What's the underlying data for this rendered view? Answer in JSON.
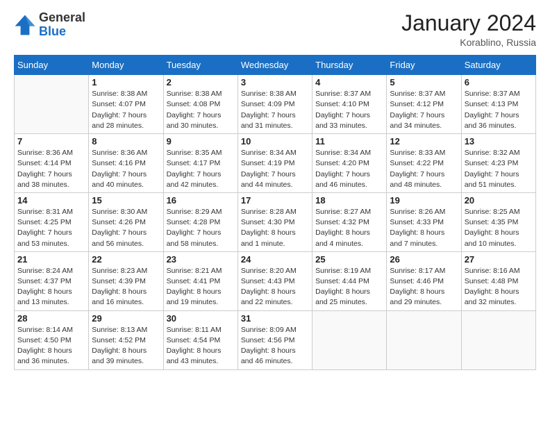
{
  "logo": {
    "general": "General",
    "blue": "Blue"
  },
  "title": "January 2024",
  "location": "Korablino, Russia",
  "days_header": [
    "Sunday",
    "Monday",
    "Tuesday",
    "Wednesday",
    "Thursday",
    "Friday",
    "Saturday"
  ],
  "weeks": [
    [
      {
        "day": "",
        "info": ""
      },
      {
        "day": "1",
        "info": "Sunrise: 8:38 AM\nSunset: 4:07 PM\nDaylight: 7 hours\nand 28 minutes."
      },
      {
        "day": "2",
        "info": "Sunrise: 8:38 AM\nSunset: 4:08 PM\nDaylight: 7 hours\nand 30 minutes."
      },
      {
        "day": "3",
        "info": "Sunrise: 8:38 AM\nSunset: 4:09 PM\nDaylight: 7 hours\nand 31 minutes."
      },
      {
        "day": "4",
        "info": "Sunrise: 8:37 AM\nSunset: 4:10 PM\nDaylight: 7 hours\nand 33 minutes."
      },
      {
        "day": "5",
        "info": "Sunrise: 8:37 AM\nSunset: 4:12 PM\nDaylight: 7 hours\nand 34 minutes."
      },
      {
        "day": "6",
        "info": "Sunrise: 8:37 AM\nSunset: 4:13 PM\nDaylight: 7 hours\nand 36 minutes."
      }
    ],
    [
      {
        "day": "7",
        "info": "Sunrise: 8:36 AM\nSunset: 4:14 PM\nDaylight: 7 hours\nand 38 minutes."
      },
      {
        "day": "8",
        "info": "Sunrise: 8:36 AM\nSunset: 4:16 PM\nDaylight: 7 hours\nand 40 minutes."
      },
      {
        "day": "9",
        "info": "Sunrise: 8:35 AM\nSunset: 4:17 PM\nDaylight: 7 hours\nand 42 minutes."
      },
      {
        "day": "10",
        "info": "Sunrise: 8:34 AM\nSunset: 4:19 PM\nDaylight: 7 hours\nand 44 minutes."
      },
      {
        "day": "11",
        "info": "Sunrise: 8:34 AM\nSunset: 4:20 PM\nDaylight: 7 hours\nand 46 minutes."
      },
      {
        "day": "12",
        "info": "Sunrise: 8:33 AM\nSunset: 4:22 PM\nDaylight: 7 hours\nand 48 minutes."
      },
      {
        "day": "13",
        "info": "Sunrise: 8:32 AM\nSunset: 4:23 PM\nDaylight: 7 hours\nand 51 minutes."
      }
    ],
    [
      {
        "day": "14",
        "info": "Sunrise: 8:31 AM\nSunset: 4:25 PM\nDaylight: 7 hours\nand 53 minutes."
      },
      {
        "day": "15",
        "info": "Sunrise: 8:30 AM\nSunset: 4:26 PM\nDaylight: 7 hours\nand 56 minutes."
      },
      {
        "day": "16",
        "info": "Sunrise: 8:29 AM\nSunset: 4:28 PM\nDaylight: 7 hours\nand 58 minutes."
      },
      {
        "day": "17",
        "info": "Sunrise: 8:28 AM\nSunset: 4:30 PM\nDaylight: 8 hours\nand 1 minute."
      },
      {
        "day": "18",
        "info": "Sunrise: 8:27 AM\nSunset: 4:32 PM\nDaylight: 8 hours\nand 4 minutes."
      },
      {
        "day": "19",
        "info": "Sunrise: 8:26 AM\nSunset: 4:33 PM\nDaylight: 8 hours\nand 7 minutes."
      },
      {
        "day": "20",
        "info": "Sunrise: 8:25 AM\nSunset: 4:35 PM\nDaylight: 8 hours\nand 10 minutes."
      }
    ],
    [
      {
        "day": "21",
        "info": "Sunrise: 8:24 AM\nSunset: 4:37 PM\nDaylight: 8 hours\nand 13 minutes."
      },
      {
        "day": "22",
        "info": "Sunrise: 8:23 AM\nSunset: 4:39 PM\nDaylight: 8 hours\nand 16 minutes."
      },
      {
        "day": "23",
        "info": "Sunrise: 8:21 AM\nSunset: 4:41 PM\nDaylight: 8 hours\nand 19 minutes."
      },
      {
        "day": "24",
        "info": "Sunrise: 8:20 AM\nSunset: 4:43 PM\nDaylight: 8 hours\nand 22 minutes."
      },
      {
        "day": "25",
        "info": "Sunrise: 8:19 AM\nSunset: 4:44 PM\nDaylight: 8 hours\nand 25 minutes."
      },
      {
        "day": "26",
        "info": "Sunrise: 8:17 AM\nSunset: 4:46 PM\nDaylight: 8 hours\nand 29 minutes."
      },
      {
        "day": "27",
        "info": "Sunrise: 8:16 AM\nSunset: 4:48 PM\nDaylight: 8 hours\nand 32 minutes."
      }
    ],
    [
      {
        "day": "28",
        "info": "Sunrise: 8:14 AM\nSunset: 4:50 PM\nDaylight: 8 hours\nand 36 minutes."
      },
      {
        "day": "29",
        "info": "Sunrise: 8:13 AM\nSunset: 4:52 PM\nDaylight: 8 hours\nand 39 minutes."
      },
      {
        "day": "30",
        "info": "Sunrise: 8:11 AM\nSunset: 4:54 PM\nDaylight: 8 hours\nand 43 minutes."
      },
      {
        "day": "31",
        "info": "Sunrise: 8:09 AM\nSunset: 4:56 PM\nDaylight: 8 hours\nand 46 minutes."
      },
      {
        "day": "",
        "info": ""
      },
      {
        "day": "",
        "info": ""
      },
      {
        "day": "",
        "info": ""
      }
    ]
  ]
}
